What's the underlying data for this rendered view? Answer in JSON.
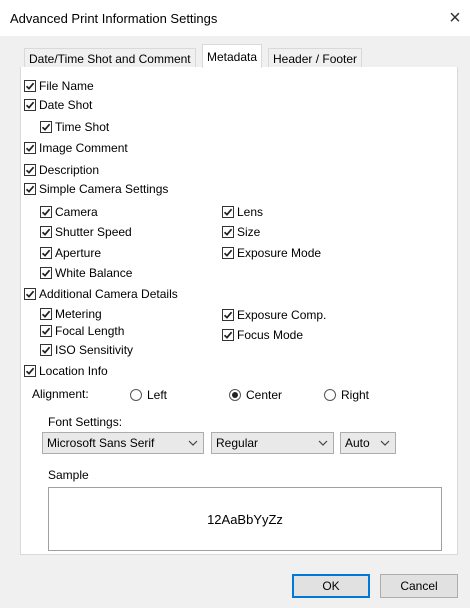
{
  "window": {
    "title": "Advanced Print Information Settings",
    "close_glyph": "×"
  },
  "tabs": [
    {
      "label": "Date/Time Shot and Comment",
      "active": false
    },
    {
      "label": "Metadata",
      "active": true
    },
    {
      "label": "Header / Footer",
      "active": false
    }
  ],
  "metadata": {
    "file_name": "File Name",
    "date_shot": "Date Shot",
    "time_shot": "Time Shot",
    "image_comment": "Image Comment",
    "description": "Description",
    "simple_camera_settings": "Simple Camera Settings",
    "camera": "Camera",
    "shutter_speed": "Shutter Speed",
    "aperture": "Aperture",
    "white_balance": "White Balance",
    "lens": "Lens",
    "size": "Size",
    "exposure_mode": "Exposure Mode",
    "additional_camera_details": "Additional Camera Details",
    "metering": "Metering",
    "focal_length": "Focal Length",
    "iso_sensitivity": "ISO Sensitivity",
    "exposure_comp": "Exposure Comp.",
    "focus_mode": "Focus Mode",
    "location_info": "Location Info"
  },
  "alignment": {
    "label": "Alignment:",
    "left": "Left",
    "center": "Center",
    "right": "Right",
    "selected": "Center"
  },
  "font_settings": {
    "label": "Font Settings:",
    "font": "Microsoft Sans Serif",
    "style": "Regular",
    "size": "Auto"
  },
  "sample": {
    "label": "Sample",
    "text": "12AaBbYyZz"
  },
  "buttons": {
    "ok": "OK",
    "cancel": "Cancel"
  },
  "colors": {
    "accent": "#0078d7",
    "check": "#222222"
  }
}
